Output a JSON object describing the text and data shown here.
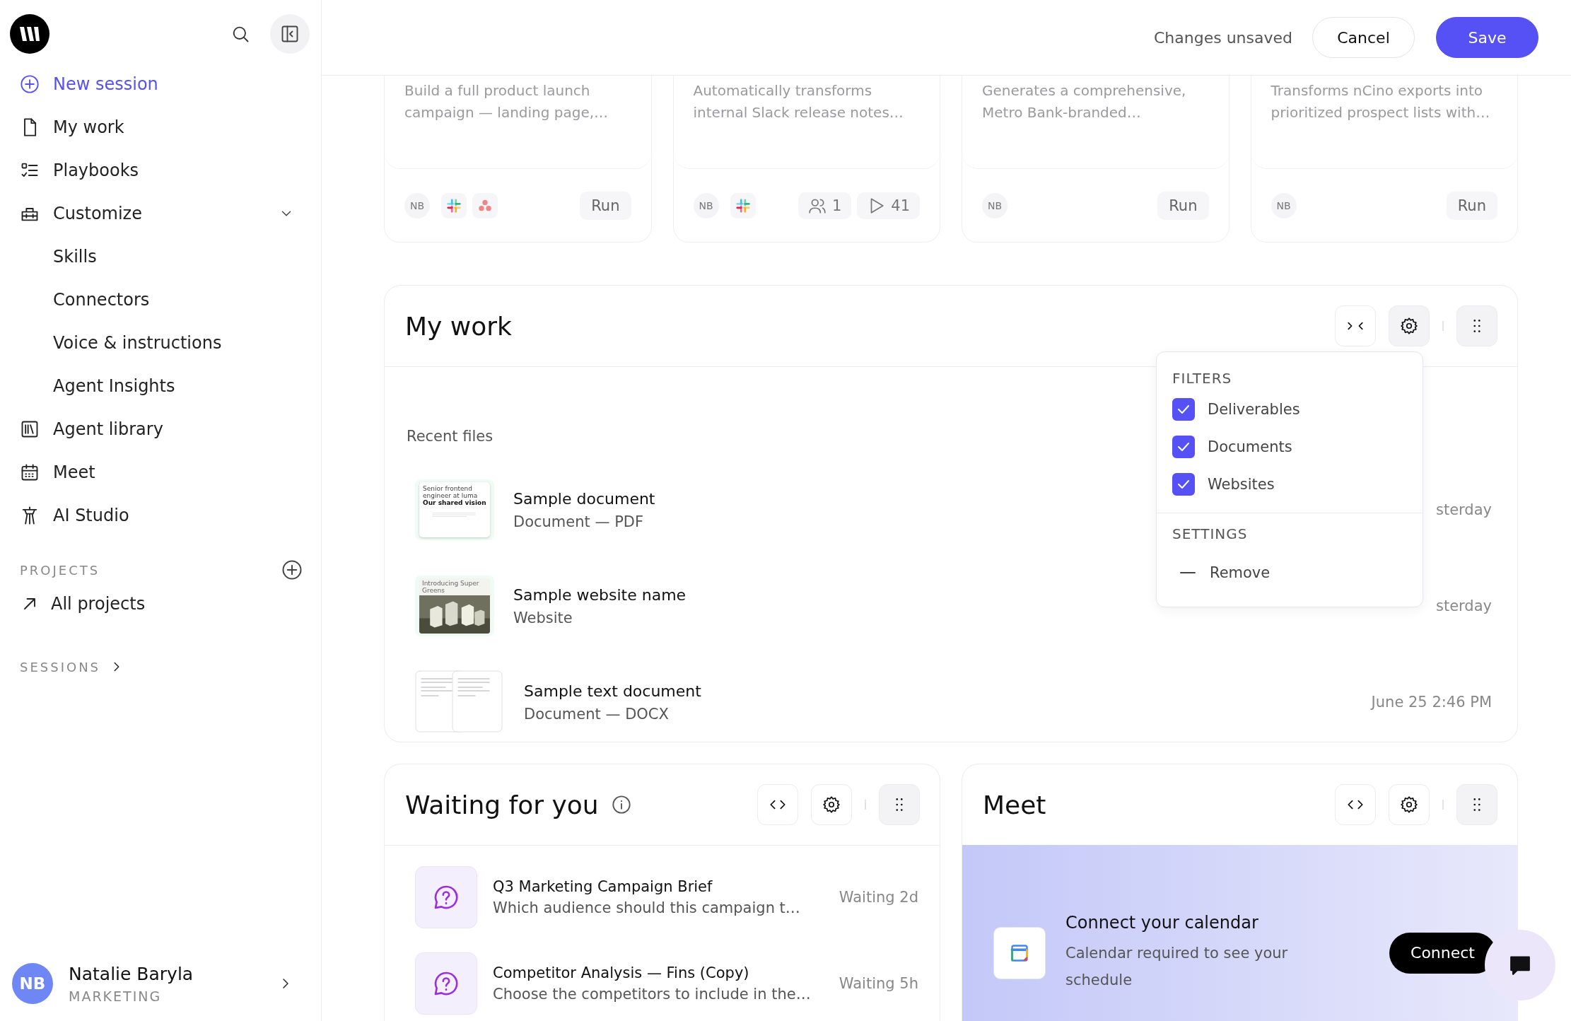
{
  "sidebar": {
    "nav": [
      {
        "label": "New session",
        "kind": "action"
      },
      {
        "label": "My work",
        "kind": "link"
      },
      {
        "label": "Playbooks",
        "kind": "link"
      },
      {
        "label": "Customize",
        "kind": "group",
        "expanded": true,
        "children": [
          {
            "label": "Skills"
          },
          {
            "label": "Connectors"
          },
          {
            "label": "Voice & instructions"
          },
          {
            "label": "Agent Insights"
          }
        ]
      },
      {
        "label": "Agent library",
        "kind": "link"
      },
      {
        "label": "Meet",
        "kind": "link"
      },
      {
        "label": "AI Studio",
        "kind": "link"
      }
    ],
    "projects": {
      "heading": "PROJECTS",
      "items": [
        {
          "label": "All projects"
        }
      ]
    },
    "sessions": {
      "heading": "SESSIONS"
    },
    "user": {
      "initials": "NB",
      "name": "Natalie Baryla",
      "team": "MARKETING"
    }
  },
  "header": {
    "status": "Changes unsaved",
    "buttons": [
      {
        "label": "Cancel",
        "kind": "secondary"
      },
      {
        "label": "Save",
        "kind": "primary"
      }
    ]
  },
  "agents": [
    {
      "description": "Build a full product launch campaign — landing page,…",
      "owner": "NB",
      "apps": [
        {
          "kind": "slack"
        },
        {
          "kind": "asana"
        }
      ],
      "action": "Run"
    },
    {
      "description": "Automatically transforms internal Slack release notes…",
      "owner": "NB",
      "apps": [
        {
          "kind": "slack"
        }
      ],
      "stats": [
        {
          "kind": "users",
          "value": "1"
        },
        {
          "kind": "runs",
          "value": "41"
        }
      ]
    },
    {
      "description": "Generates a comprehensive, Metro Bank-branded…",
      "owner": "NB",
      "action": "Run"
    },
    {
      "description": "Transforms nCino exports into prioritized prospect lists with…",
      "owner": "NB",
      "action": "Run"
    }
  ],
  "my_work": {
    "title": "My work",
    "settings_open": true,
    "section": "Recent files",
    "files": [
      {
        "kind": "pdf",
        "thumbnail_title": "Senior frontend engineer at luma",
        "thumbnail_subtitle": "Our shared vision",
        "name": "Sample document",
        "type": "Document — PDF",
        "time": "sterday"
      },
      {
        "kind": "website",
        "thumbnail_title": "Introducing Super Greens",
        "name": "Sample website name",
        "type": "Website",
        "time": "sterday"
      },
      {
        "kind": "docx",
        "name": "Sample text document",
        "type": "Document — DOCX",
        "time": "June 25 2:46 PM"
      }
    ],
    "filter_menu": {
      "filters_heading": "FILTERS",
      "filters": [
        {
          "label": "Deliverables",
          "checked": true
        },
        {
          "label": "Documents",
          "checked": true
        },
        {
          "label": "Websites",
          "checked": true
        }
      ],
      "settings_heading": "SETTINGS",
      "settings": [
        {
          "label": "Remove"
        }
      ]
    }
  },
  "waiting": {
    "title": "Waiting for you",
    "settings_open": false,
    "items": [
      {
        "title": "Q3 Marketing Campaign Brief",
        "text": "Which audience should this campaign t…",
        "status": "Waiting 2d"
      },
      {
        "title": "Competitor Analysis — Fins (Copy)",
        "text": "Choose the competitors to include in the…",
        "status": "Waiting 5h"
      }
    ]
  },
  "meet": {
    "title": "Meet",
    "settings_open": false,
    "prompt": {
      "title": "Connect your calendar",
      "text": "Calendar required to see your schedule",
      "button": "Connect"
    }
  }
}
